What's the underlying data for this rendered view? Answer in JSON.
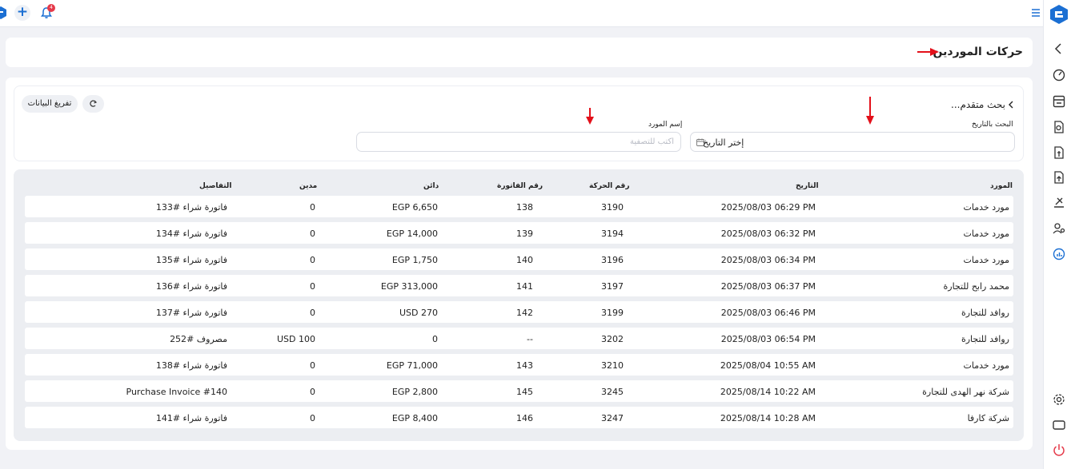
{
  "topbar": {
    "notification_count": "4",
    "plus_icon": "plus-icon",
    "bell_icon": "bell-icon"
  },
  "page": {
    "title": "حركات الموردين"
  },
  "filters": {
    "advanced_search": "بحث متقدم...",
    "clear_button": "تفريغ البيانات",
    "date_label": "البحث بالتاريخ",
    "date_placeholder": "إختر التاريخ",
    "supplier_label": "إسم المورد",
    "supplier_placeholder": "أكتب للتصفية"
  },
  "table": {
    "headers": {
      "supplier": "المورد",
      "date": "التاريخ",
      "movement_no": "رقم الحركة",
      "invoice_no": "رقم الفاتورة",
      "credit": "دائن",
      "debit": "مدين",
      "details": "التفاصيل"
    },
    "rows": [
      {
        "supplier": "مورد خدمات",
        "date": "2025/08/03 06:29 PM",
        "movement_no": "3190",
        "invoice_no": "138",
        "credit": "EGP 6,650",
        "debit": "0",
        "details": "فاتورة شراء #133"
      },
      {
        "supplier": "مورد خدمات",
        "date": "2025/08/03 06:32 PM",
        "movement_no": "3194",
        "invoice_no": "139",
        "credit": "EGP 14,000",
        "debit": "0",
        "details": "فاتورة شراء #134"
      },
      {
        "supplier": "مورد خدمات",
        "date": "2025/08/03 06:34 PM",
        "movement_no": "3196",
        "invoice_no": "140",
        "credit": "EGP 1,750",
        "debit": "0",
        "details": "فاتورة شراء #135"
      },
      {
        "supplier": "محمد رابح للتجارة",
        "date": "2025/08/03 06:37 PM",
        "movement_no": "3197",
        "invoice_no": "141",
        "credit": "EGP 313,000",
        "debit": "0",
        "details": "فاتورة شراء #136"
      },
      {
        "supplier": "روافد للتجارة",
        "date": "2025/08/03 06:46 PM",
        "movement_no": "3199",
        "invoice_no": "142",
        "credit": "USD 270",
        "debit": "0",
        "details": "فاتورة شراء #137"
      },
      {
        "supplier": "روافد للتجارة",
        "date": "2025/08/03 06:54 PM",
        "movement_no": "3202",
        "invoice_no": "--",
        "credit": "0",
        "debit": "USD 100",
        "details": "مصروف #252"
      },
      {
        "supplier": "مورد خدمات",
        "date": "2025/08/04 10:55 AM",
        "movement_no": "3210",
        "invoice_no": "143",
        "credit": "EGP 71,000",
        "debit": "0",
        "details": "فاتورة شراء #138"
      },
      {
        "supplier": "شركة  نهر الهدى للتجارة",
        "date": "2025/08/14 10:22 AM",
        "movement_no": "3245",
        "invoice_no": "145",
        "credit": "EGP 2,800",
        "debit": "0",
        "details": "Purchase Invoice #140"
      },
      {
        "supplier": "شركة كارفا",
        "date": "2025/08/14 10:28 AM",
        "movement_no": "3247",
        "invoice_no": "146",
        "credit": "EGP 8,400",
        "debit": "0",
        "details": "فاتورة شراء #141"
      }
    ]
  },
  "rail_icons": [
    "chevron-left-icon",
    "speedometer-icon",
    "register-icon",
    "search-doc-icon",
    "file-dollar-icon",
    "file-upload-icon",
    "hand-coins-icon",
    "users-cog-icon",
    "chart-icon",
    "gear-icon",
    "monitor-icon",
    "power-icon"
  ],
  "colors": {
    "accent": "#1b6fd3",
    "annotation": "#e3101a",
    "badge": "#e53949"
  }
}
